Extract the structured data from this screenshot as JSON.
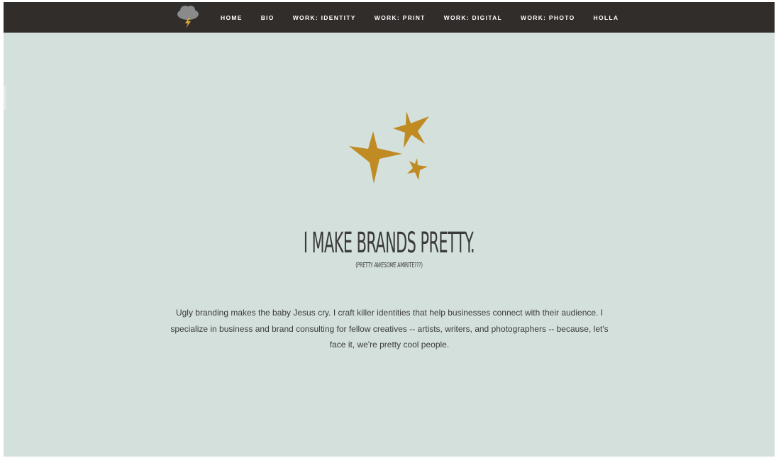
{
  "nav": {
    "logo_icon": "storm-cloud-lightning-icon",
    "items": [
      {
        "label": "HOME"
      },
      {
        "label": "BIO"
      },
      {
        "label": "WORK: IDENTITY"
      },
      {
        "label": "WORK: PRINT"
      },
      {
        "label": "WORK: DIGITAL"
      },
      {
        "label": "WORK: PHOTO"
      },
      {
        "label": "HOLLA"
      }
    ]
  },
  "hero": {
    "icon": "three-stars-icon",
    "headline": "I MAKE BRANDS PRETTY.",
    "subline_prefix": "(PRETTY ",
    "subline_italic": "AWESOME",
    "subline_suffix": " AMIRITE???)",
    "intro": "Ugly branding makes the baby Jesus cry. I craft killer identities that help businesses connect with their audience. I specialize in business and brand consulting for fellow creatives -- artists, writers, and photographers -- because, let's face it, we're pretty cool people."
  },
  "colors": {
    "background": "#d3e0dc",
    "navbar": "#302d2b",
    "stars": "#c08b22",
    "cloud": "#8a8a8a",
    "bolt": "#d7a93a",
    "text": "#3a3a3a"
  }
}
